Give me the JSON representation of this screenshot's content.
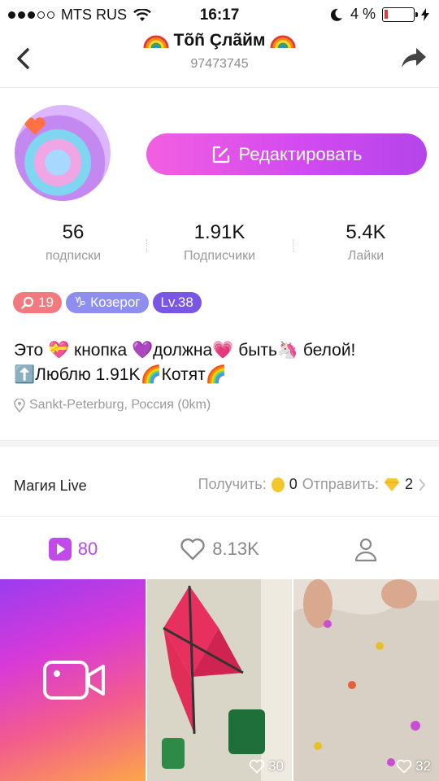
{
  "status_bar": {
    "carrier": "MTS RUS",
    "time": "16:17",
    "battery_text": "4 %",
    "battery_level_percent": 4
  },
  "nav": {
    "title": "Tõñ Çлãйм",
    "id": "97473745"
  },
  "profile": {
    "edit_label": "Редактировать"
  },
  "stats": [
    {
      "value": "56",
      "label": "подписки"
    },
    {
      "value": "1.91K",
      "label": "Подписчики"
    },
    {
      "value": "5.4K",
      "label": "Лайки"
    }
  ],
  "badges": {
    "views": "19",
    "zodiac": "Козерог",
    "level": "Lv.38"
  },
  "bio": {
    "line1_a": "Это ",
    "line1_b": "кнопка ",
    "line1_c": "должна",
    "line1_d": " быть",
    "line1_e": " белой!",
    "line2_a": "Люблю 1.91K",
    "line2_b": "Котят"
  },
  "location": "Sankt-Peterburg, Россия (0km)",
  "magic": {
    "label": "Магия Live",
    "receive_label": "Получить:",
    "receive_value": "0",
    "send_label": "Отправить:",
    "send_value": "2"
  },
  "tabs": [
    {
      "value": "80"
    },
    {
      "value": "8.13K"
    },
    {
      "value": ""
    }
  ],
  "grid": [
    {
      "likes": ""
    },
    {
      "likes": "30"
    },
    {
      "likes": "32"
    }
  ],
  "colors": {
    "accent": "#b84be8",
    "edit_gradient_start": "#f35fe0",
    "edit_gradient_end": "#b445ea"
  }
}
